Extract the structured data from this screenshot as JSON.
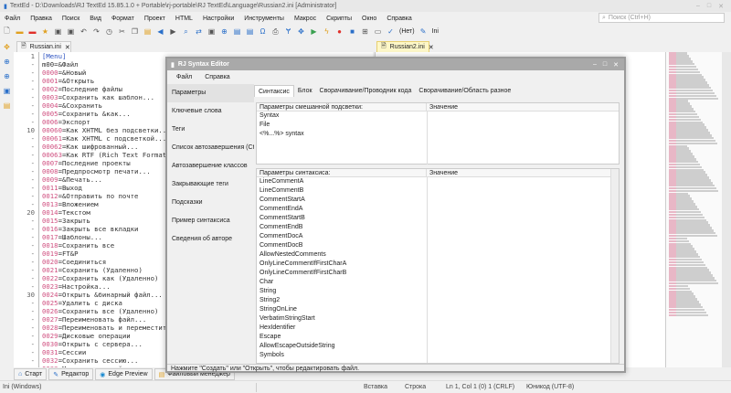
{
  "window": {
    "title": "TextEd - D:\\Downloads\\RJ TextEd 15.85.1.0 + Portable\\rj-portable\\RJ TextEd\\Language\\Russian2.ini [Administrator]"
  },
  "menu": [
    "Файл",
    "Правка",
    "Поиск",
    "Вид",
    "Формат",
    "Проект",
    "HTML",
    "Настройки",
    "Инструменты",
    "Макрос",
    "Скрипты",
    "Окно",
    "Справка"
  ],
  "search": {
    "placeholder": "Поиск (Ctrl+H)"
  },
  "toolbar": {
    "spell_label": "(Нет)",
    "syntax_label": "Ini"
  },
  "tabs": {
    "left": "Russian.ini",
    "right": "Russian2.ini"
  },
  "editor": {
    "line_numbers": [
      "1",
      "-",
      "-",
      "-",
      "-",
      "-",
      "-",
      "-",
      "-",
      "10",
      "-",
      "-",
      "-",
      "-",
      "-",
      "-",
      "-",
      "-",
      "-",
      "20",
      "-",
      "-",
      "-",
      "-",
      "-",
      "-",
      "-",
      "-",
      "-",
      "30",
      "-",
      "-",
      "-",
      "-",
      "-",
      "-",
      "-",
      "-",
      "-"
    ],
    "lines": [
      {
        "k": "",
        "v": "[Menu]"
      },
      {
        "k": "",
        "v": "m00=&Файл"
      },
      {
        "k": "0000",
        "v": "=&Новый"
      },
      {
        "k": "0001",
        "v": "=&Открыть"
      },
      {
        "k": "0002",
        "v": "=Последние файлы"
      },
      {
        "k": "0003",
        "v": "=Сохранить как шаблон..."
      },
      {
        "k": "0004",
        "v": "=&Сохранить"
      },
      {
        "k": "0005",
        "v": "=Сохранить &как..."
      },
      {
        "k": "0006",
        "v": "=Экспорт"
      },
      {
        "k": "00060",
        "v": "=Как XHTML без подсветки..."
      },
      {
        "k": "00061",
        "v": "=Как XHTML с подсветкой..."
      },
      {
        "k": "00062",
        "v": "=Как шифрованный..."
      },
      {
        "k": "00063",
        "v": "=Как RTF (Rich Text Format)"
      },
      {
        "k": "0007",
        "v": "=Последние проекты"
      },
      {
        "k": "0008",
        "v": "=Предпросмотр печати..."
      },
      {
        "k": "0009",
        "v": "=&Печать..."
      },
      {
        "k": "0011",
        "v": "=Выход"
      },
      {
        "k": "0012",
        "v": "=&Отправить по почте"
      },
      {
        "k": "0013",
        "v": "=Вложением"
      },
      {
        "k": "0014",
        "v": "=Текстом"
      },
      {
        "k": "0015",
        "v": "=Закрыть"
      },
      {
        "k": "0016",
        "v": "=Закрыть все вкладки"
      },
      {
        "k": "0017",
        "v": "=Шаблоны..."
      },
      {
        "k": "0018",
        "v": "=Сохранить все"
      },
      {
        "k": "0019",
        "v": "=FT&P"
      },
      {
        "k": "0020",
        "v": "=Соединиться"
      },
      {
        "k": "0021",
        "v": "=Сохранить (Удаленно)"
      },
      {
        "k": "0022",
        "v": "=Сохранить как (Удаленно)"
      },
      {
        "k": "0023",
        "v": "=Настройка..."
      },
      {
        "k": "0024",
        "v": "=Открыть &бинарный файл..."
      },
      {
        "k": "0025",
        "v": "=Удалить с диска"
      },
      {
        "k": "0026",
        "v": "=Сохранить все (Удаленно)"
      },
      {
        "k": "0027",
        "v": "=Переименовать файл..."
      },
      {
        "k": "0028",
        "v": "=Переименовать и переместить ф"
      },
      {
        "k": "0029",
        "v": "=Дисковые операции"
      },
      {
        "k": "0030",
        "v": "=Открыть с сервера..."
      },
      {
        "k": "0031",
        "v": "=Сессии"
      },
      {
        "k": "0032",
        "v": "=Сохранить сессию..."
      },
      {
        "k": "0033",
        "v": "=Менеджер сессий..."
      }
    ]
  },
  "bottom_tabs": [
    "Старт",
    "Редактор",
    "Edge Preview",
    "Файловый менеджер"
  ],
  "status": {
    "mode": "Ini (Windows)",
    "insert": "Вставка",
    "line": "Строка",
    "position": "Ln 1, Col 1 (0) 1 (CRLF)",
    "encoding": "Юникод (UTF-8)"
  },
  "dialog": {
    "title": "RJ Syntax Editor",
    "menu": [
      "Файл",
      "Справка"
    ],
    "nav": [
      "Параметры",
      "Ключевые слова",
      "Теги",
      "Список автозавершения (Ctrl+",
      "Автозавершение классов",
      "Закрывающие теги",
      "Подсказки",
      "Пример синтаксиса",
      "Сведения об авторе"
    ],
    "tabs": [
      "Синтаксис",
      "Блок",
      "Сворачивание/Проводник кода",
      "Сворачивание/Область разное"
    ],
    "table1": {
      "col1": "Параметры смешанной подсветки:",
      "col2": "Значение",
      "rows": [
        "Syntax",
        "File",
        "<%...%> syntax"
      ]
    },
    "table2": {
      "col1": "Параметры синтаксиса:",
      "col2": "Значение",
      "rows": [
        "LineCommentA",
        "LineCommentB",
        "CommentStartA",
        "CommentEndA",
        "CommentStartB",
        "CommentEndB",
        "CommentDocA",
        "CommentDocB",
        "AllowNestedComments",
        "OnlyLineCommentIfFirstCharA",
        "OnlyLineCommentIfFirstCharB",
        "Char",
        "String",
        "String2",
        "StringOnLine",
        "VerbatimStringStart",
        "HexIdentifier",
        "Escape",
        "AllowEscapeOutsideString",
        "Symbols"
      ]
    },
    "status": "Нажмите \"Создать\" или \"Открыть\", чтобы редактировать файл."
  }
}
